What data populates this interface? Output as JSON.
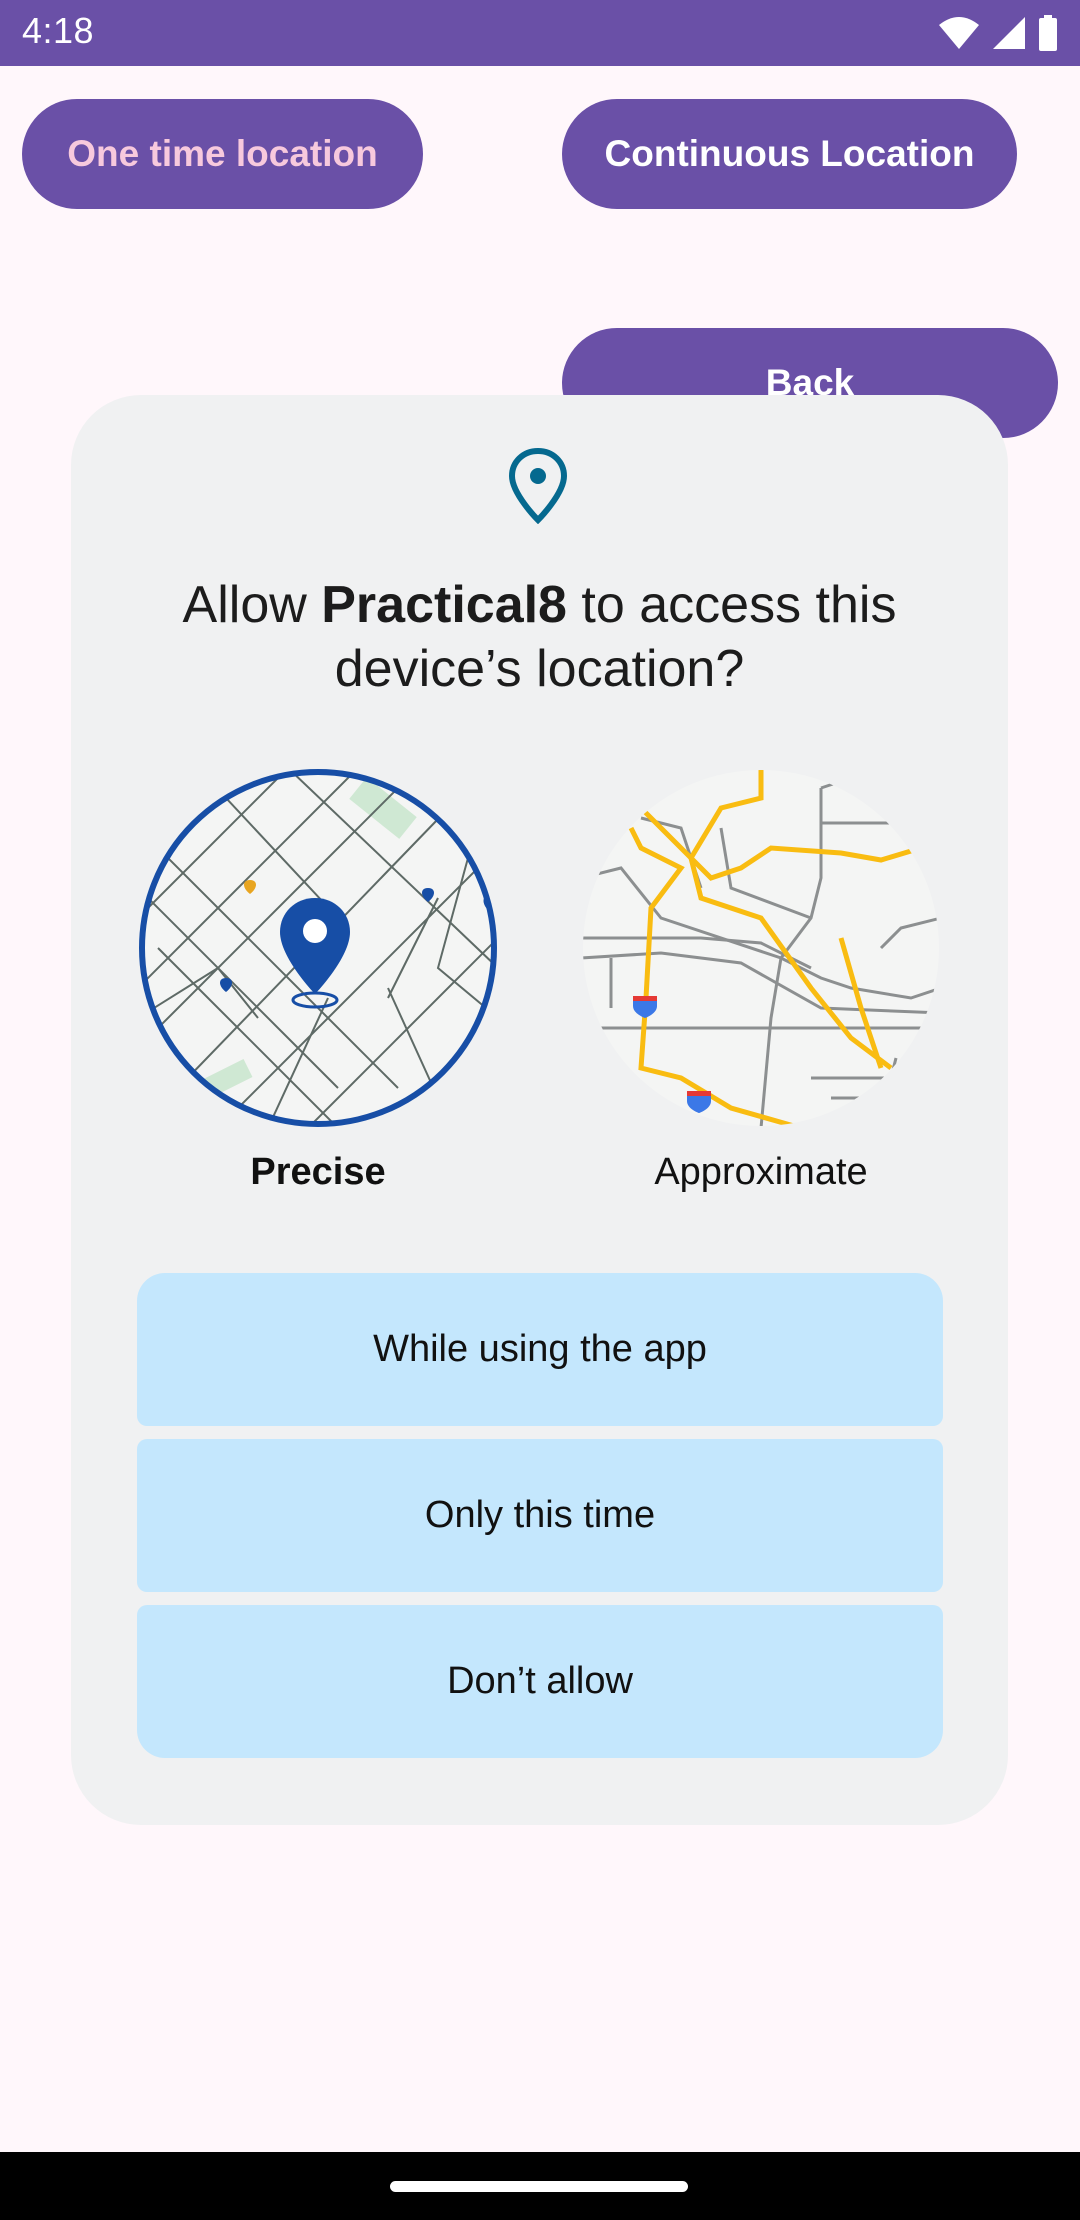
{
  "status_bar": {
    "time": "4:18"
  },
  "app": {
    "one_time_button": "One time location",
    "continuous_button": "Continuous Location",
    "back_button": "Back"
  },
  "dialog": {
    "title_prefix": "Allow ",
    "app_name": "Practical8",
    "title_suffix": " to access this device’s location?",
    "precise_label": "Precise",
    "approximate_label": "Approximate",
    "options": {
      "while_using": "While using the app",
      "only_this_time": "Only this time",
      "dont_allow": "Don’t allow"
    }
  },
  "colors": {
    "accent": "#6A50A7",
    "dialog_bg": "#F0F1F2",
    "option_bg": "#C4E7FD",
    "pin_precise": "#174EA6",
    "pin_dialog": "#05698F",
    "road_major": "#F9BC11"
  },
  "icons": [
    "location-pin-icon",
    "wifi-icon",
    "signal-icon",
    "battery-icon"
  ]
}
